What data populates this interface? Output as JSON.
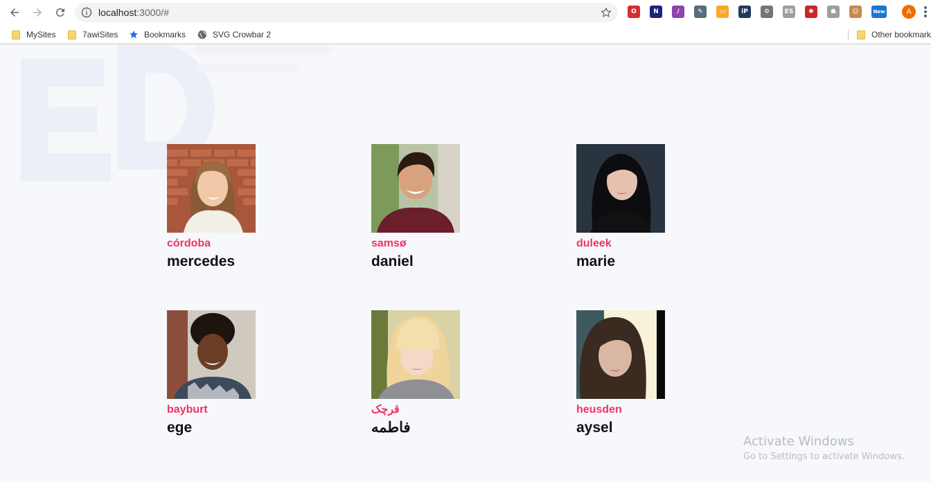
{
  "browser": {
    "url_host": "localhost",
    "url_rest": ":3000/#",
    "bookmarks": [
      {
        "label": "MySites",
        "icon": "folder-icon"
      },
      {
        "label": "7awiSites",
        "icon": "folder-icon"
      },
      {
        "label": "Bookmarks",
        "icon": "star-icon"
      },
      {
        "label": "SVG Crowbar 2",
        "icon": "globe-icon"
      }
    ],
    "other_bookmarks": "Other bookmarks",
    "profile_initial": "A",
    "extensions": [
      {
        "name": "opera-icon",
        "color": "#d32f2f",
        "glyph": "O"
      },
      {
        "name": "n-extension-icon",
        "color": "#1a237e",
        "glyph": "N"
      },
      {
        "name": "feather-icon",
        "color": "#8e44ad",
        "glyph": "/"
      },
      {
        "name": "eyedropper-icon",
        "color": "#546e7a",
        "glyph": "✎"
      },
      {
        "name": "ruler-icon",
        "color": "#f9a825",
        "glyph": "▭"
      },
      {
        "name": "ip-icon",
        "color": "#1e3a5f",
        "glyph": "iP"
      },
      {
        "name": "gear-extension-icon",
        "color": "#757575",
        "glyph": "⚙"
      },
      {
        "name": "es-icon",
        "color": "#9e9e9e",
        "glyph": "ES"
      },
      {
        "name": "puzzle-red-icon",
        "color": "#c62828",
        "glyph": "✱"
      },
      {
        "name": "android-icon",
        "color": "#9e9e9e",
        "glyph": "☗"
      },
      {
        "name": "face-icon",
        "color": "#c58b4a",
        "glyph": "☺"
      },
      {
        "name": "new-badge-icon",
        "color": "#1976d2",
        "glyph": "New"
      }
    ]
  },
  "people": [
    {
      "city": "córdoba",
      "name": "mercedes"
    },
    {
      "city": "samsø",
      "name": "daniel"
    },
    {
      "city": "duleek",
      "name": "marie"
    },
    {
      "city": "bayburt",
      "name": "ege"
    },
    {
      "city": "قرچک",
      "name": "فاطمه"
    },
    {
      "city": "heusden",
      "name": "aysel"
    }
  ],
  "watermark": {
    "title": "Activate Windows",
    "subtitle": "Go to Settings to activate Windows."
  }
}
